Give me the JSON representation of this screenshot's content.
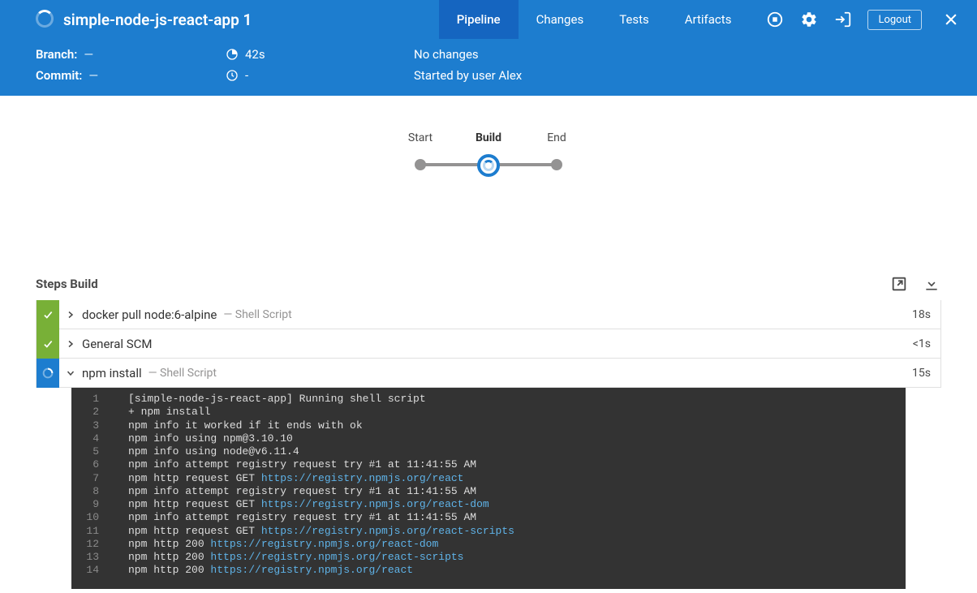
{
  "header": {
    "title": "simple-node-js-react-app 1",
    "tabs": [
      {
        "label": "Pipeline",
        "active": true
      },
      {
        "label": "Changes",
        "active": false
      },
      {
        "label": "Tests",
        "active": false
      },
      {
        "label": "Artifacts",
        "active": false
      }
    ],
    "logout_label": "Logout"
  },
  "info": {
    "branch_label": "Branch:",
    "branch_value": "—",
    "commit_label": "Commit:",
    "commit_value": "—",
    "duration": "42s",
    "finished": "-",
    "changes": "No changes",
    "started_by": "Started by user Alex"
  },
  "pipeline": {
    "stages": [
      {
        "label": "Start",
        "active": false
      },
      {
        "label": "Build",
        "active": true
      },
      {
        "label": "End",
        "active": false
      }
    ]
  },
  "steps": {
    "title": "Steps Build",
    "items": [
      {
        "status": "success",
        "expanded": false,
        "name": "docker pull node:6-alpine",
        "subtitle": "— Shell Script",
        "duration": "18s"
      },
      {
        "status": "success",
        "expanded": false,
        "name": "General SCM",
        "subtitle": "",
        "duration": "<1s"
      },
      {
        "status": "running",
        "expanded": true,
        "name": "npm install",
        "subtitle": "— Shell Script",
        "duration": "15s"
      }
    ]
  },
  "console": [
    {
      "n": "1",
      "text": "[simple-node-js-react-app] Running shell script"
    },
    {
      "n": "2",
      "text": "+ npm install"
    },
    {
      "n": "3",
      "text": "npm info it worked if it ends with ok"
    },
    {
      "n": "4",
      "text": "npm info using npm@3.10.10"
    },
    {
      "n": "5",
      "text": "npm info using node@v6.11.4"
    },
    {
      "n": "6",
      "text": "npm info attempt registry request try #1 at 11:41:55 AM"
    },
    {
      "n": "7",
      "text": "npm http request GET ",
      "url": "https://registry.npmjs.org/react"
    },
    {
      "n": "8",
      "text": "npm info attempt registry request try #1 at 11:41:55 AM"
    },
    {
      "n": "9",
      "text": "npm http request GET ",
      "url": "https://registry.npmjs.org/react-dom"
    },
    {
      "n": "10",
      "text": "npm info attempt registry request try #1 at 11:41:55 AM"
    },
    {
      "n": "11",
      "text": "npm http request GET ",
      "url": "https://registry.npmjs.org/react-scripts"
    },
    {
      "n": "12",
      "text": "npm http 200 ",
      "url": "https://registry.npmjs.org/react-dom"
    },
    {
      "n": "13",
      "text": "npm http 200 ",
      "url": "https://registry.npmjs.org/react-scripts"
    },
    {
      "n": "14",
      "text": "npm http 200 ",
      "url": "https://registry.npmjs.org/react"
    }
  ]
}
